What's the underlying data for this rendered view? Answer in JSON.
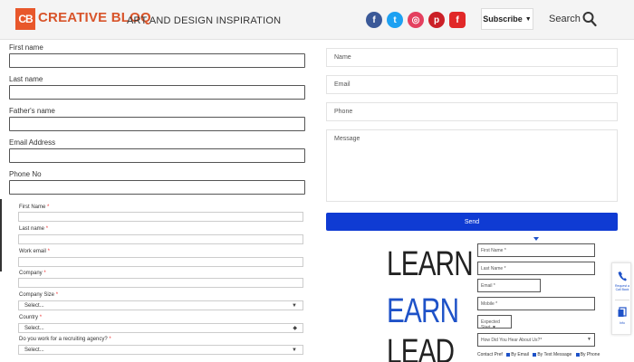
{
  "header": {
    "logo_mark": "CB",
    "logo_text": "CREATIVE BLOQ",
    "tagline": "ART AND DESIGN INSPIRATION",
    "social": [
      {
        "name": "facebook",
        "glyph": "f",
        "color": "#3b5998"
      },
      {
        "name": "twitter",
        "glyph": "t",
        "color": "#1da1f2"
      },
      {
        "name": "instagram",
        "glyph": "◎",
        "color": "#e4405f"
      },
      {
        "name": "pinterest",
        "glyph": "p",
        "color": "#cb2027"
      },
      {
        "name": "flipboard",
        "glyph": "f",
        "color": "#e12828"
      }
    ],
    "subscribe_label": "Subscribe",
    "subscribe_arrow": "▼",
    "search_label": "Search"
  },
  "main_form": {
    "first_name_label": "First name",
    "last_name_label": "Last name",
    "fathers_name_label": "Father's name",
    "email_label": "Email Address",
    "phone_label": "Phone No"
  },
  "lead_form": {
    "first_name_label": "First Name",
    "last_name_label": "Last name",
    "work_email_label": "Work email",
    "company_label": "Company",
    "company_size_label": "Company Size",
    "company_size_value": "Select...",
    "country_label": "Country",
    "country_value": "Select...",
    "recruiting_label": "Do you work for a recruiting agency?",
    "recruiting_value": "Select...",
    "required_mark": "*"
  },
  "contact_form": {
    "name_placeholder": "Name",
    "email_placeholder": "Email",
    "phone_placeholder": "Phone",
    "message_placeholder": "Message",
    "send_label": "Send"
  },
  "promo": {
    "words": [
      {
        "text": "LEARN",
        "color": "#222222"
      },
      {
        "text": "EARN",
        "color": "#1e52c8"
      },
      {
        "text": "LEAD",
        "color": "#222222"
      }
    ],
    "fields": [
      "First Name *",
      "Last Name *",
      "Email *",
      "Mobile *"
    ],
    "expected_start": "Expected Start",
    "heard_about": "How Did You Hear About Us?*",
    "contact_pref_label": "Contact Pref",
    "contact_options": [
      "By Email",
      "By Text Message",
      "By Phone"
    ]
  },
  "side_widget": {
    "call_label": "Request a Call Back",
    "info_label": "Info"
  }
}
